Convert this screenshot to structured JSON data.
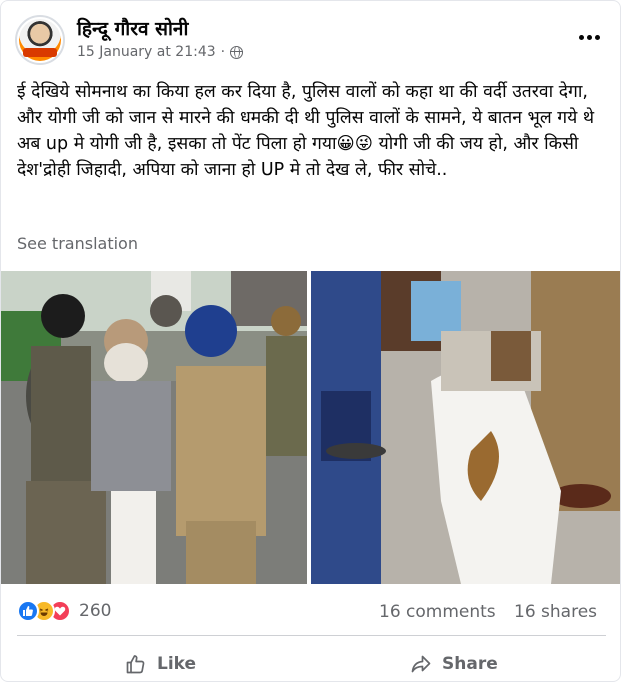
{
  "post": {
    "author": "हिन्दू गौरव सोनी",
    "timestamp": "15 January at 21:43",
    "dot": "·",
    "text": "ई देखिये सोमनाथ का किया हल कर दिया है, पुलिस वालों को कहा था की वर्दी उतरवा देगा, और योगी जी को जान से मारने की धमकी दी थी पुलिस वालों के सामने, ये बातन भूल गये थे अब up मे योगी जी है, इसका तो पेंट पिला हो गया😀😜 योगी जी की जय हो, और किसी देश'द्रोही जिहादी, अपिया को जाना हो UP मे तो देख ले, फीर सोचे..",
    "see_translation": "See translation"
  },
  "stats": {
    "reaction_count": "260",
    "comments": "16 comments",
    "shares": "16 shares"
  },
  "actions": {
    "like": "Like",
    "share": "Share"
  },
  "colors": {
    "like_blue": "#1877f2",
    "haha_yellow": "#f7b928",
    "love_red": "#f33e58",
    "meta_grey": "#65676b"
  },
  "icons": {
    "privacy": "globe-icon",
    "menu": "more-options-icon",
    "like": "thumbs-up-icon",
    "share": "share-arrow-icon"
  }
}
